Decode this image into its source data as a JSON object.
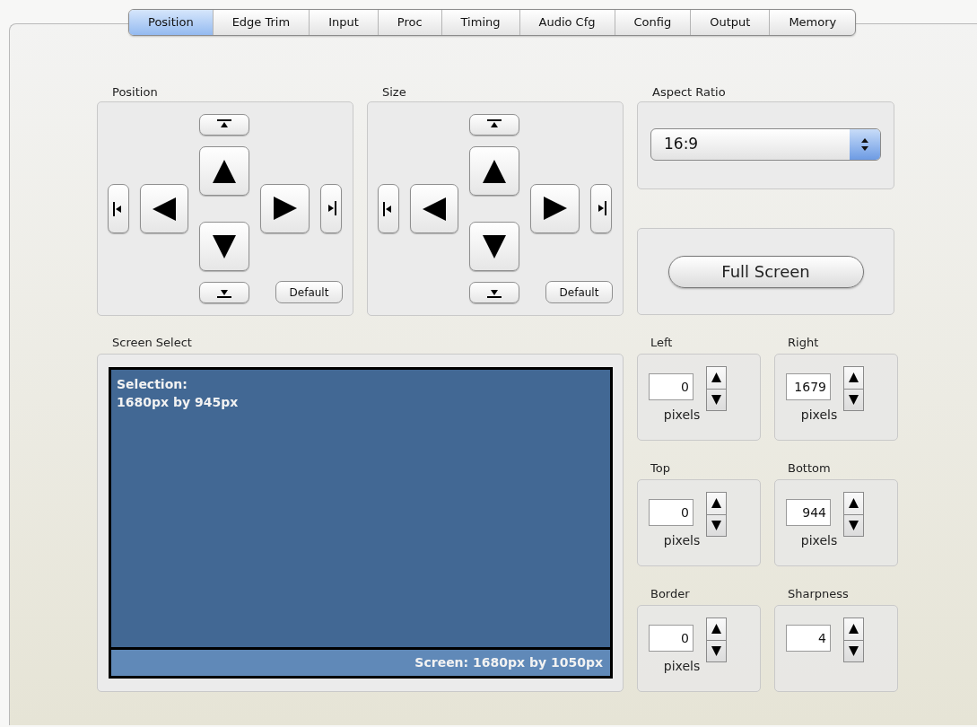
{
  "tabs": [
    {
      "label": "Position",
      "selected": true
    },
    {
      "label": "Edge Trim",
      "selected": false
    },
    {
      "label": "Input",
      "selected": false
    },
    {
      "label": "Proc",
      "selected": false
    },
    {
      "label": "Timing",
      "selected": false
    },
    {
      "label": "Audio Cfg",
      "selected": false
    },
    {
      "label": "Config",
      "selected": false
    },
    {
      "label": "Output",
      "selected": false
    },
    {
      "label": "Memory",
      "selected": false
    }
  ],
  "position": {
    "label": "Position",
    "default_button": "Default"
  },
  "size": {
    "label": "Size",
    "default_button": "Default"
  },
  "aspect_ratio": {
    "label": "Aspect Ratio",
    "value": "16:9"
  },
  "full_screen_button": "Full Screen",
  "screen_select": {
    "label": "Screen Select",
    "selection_title": "Selection:",
    "selection_size": "1680px by 945px",
    "screen_info": "Screen: 1680px by 1050px"
  },
  "fields": [
    {
      "label": "Left",
      "value": "0",
      "unit": "pixels"
    },
    {
      "label": "Right",
      "value": "1679",
      "unit": "pixels"
    },
    {
      "label": "Top",
      "value": "0",
      "unit": "pixels"
    },
    {
      "label": "Bottom",
      "value": "944",
      "unit": "pixels"
    },
    {
      "label": "Border",
      "value": "0",
      "unit": "pixels"
    },
    {
      "label": "Sharpness",
      "value": "4"
    }
  ]
}
